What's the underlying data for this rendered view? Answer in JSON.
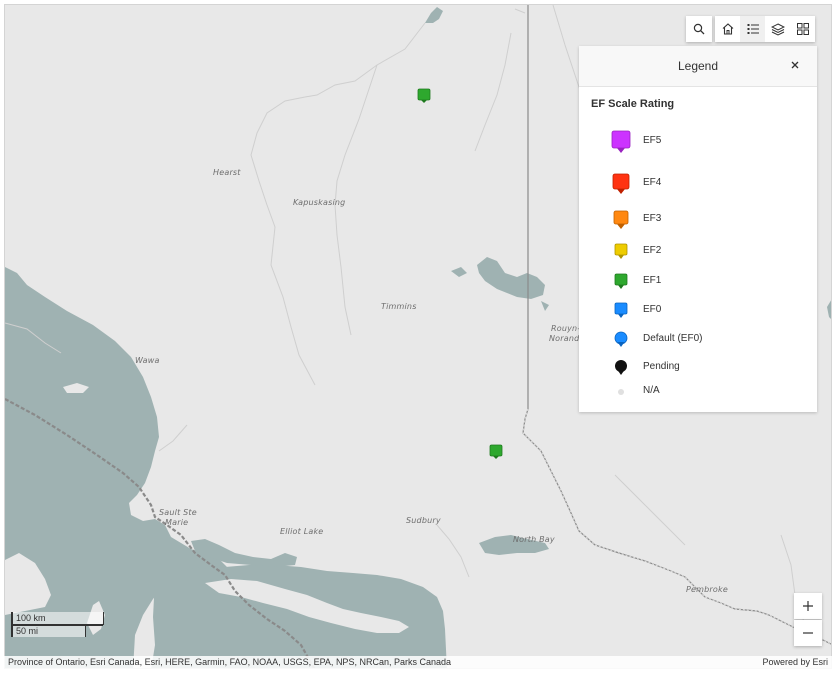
{
  "map": {
    "places": [
      {
        "name": "Hearst"
      },
      {
        "name": "Kapuskasing"
      },
      {
        "name": "Timmins"
      },
      {
        "name": "Rouyn-"
      },
      {
        "name": "Noranda"
      },
      {
        "name": "Wawa"
      },
      {
        "name": "Sault Ste"
      },
      {
        "name": "Marie"
      },
      {
        "name": "Elliot Lake"
      },
      {
        "name": "Sudbury"
      },
      {
        "name": "North Bay"
      },
      {
        "name": "Pembroke"
      }
    ],
    "markers": [
      {
        "rating": "EF1",
        "color": "#2ea82e"
      },
      {
        "rating": "EF1",
        "color": "#2ea82e"
      }
    ],
    "colors": {
      "land": "#e8e8e8",
      "water": "#9fb2b2",
      "roads": "#ffffff",
      "boundary": "#8a8a8a"
    }
  },
  "toolbar": {
    "search_icon": "search-icon",
    "home_icon": "home-icon",
    "legend_icon": "legend-list-icon",
    "layers_icon": "layers-icon",
    "basemap_icon": "basemap-gallery-icon"
  },
  "legend": {
    "title": "Legend",
    "close_icon": "close-icon",
    "subtitle": "EF Scale Rating",
    "items": [
      {
        "label": "EF5",
        "color": "#cc33ff",
        "shape": "square-pin-large"
      },
      {
        "label": "EF4",
        "color": "#ff3311",
        "shape": "square-pin"
      },
      {
        "label": "EF3",
        "color": "#ff8811",
        "shape": "square-pin"
      },
      {
        "label": "EF2",
        "color": "#eecc00",
        "shape": "square-pin"
      },
      {
        "label": "EF1",
        "color": "#2ea82e",
        "shape": "square-pin"
      },
      {
        "label": "EF0",
        "color": "#1a8cff",
        "shape": "square-pin"
      },
      {
        "label": "Default (EF0)",
        "color": "#1a8cff",
        "shape": "round-pin"
      },
      {
        "label": "Pending",
        "color": "#111111",
        "shape": "round-pin"
      },
      {
        "label": "N/A",
        "color": "#e0e0e0",
        "shape": "dot"
      }
    ]
  },
  "scalebar": {
    "metric": "100 km",
    "imperial": "50 mi"
  },
  "zoom": {
    "in_icon": "plus-icon",
    "out_icon": "minus-icon"
  },
  "attribution": {
    "text": "Province of Ontario, Esri Canada, Esri, HERE, Garmin, FAO, NOAA, USGS, EPA, NPS, NRCan, Parks Canada",
    "powered": "Powered by Esri"
  }
}
